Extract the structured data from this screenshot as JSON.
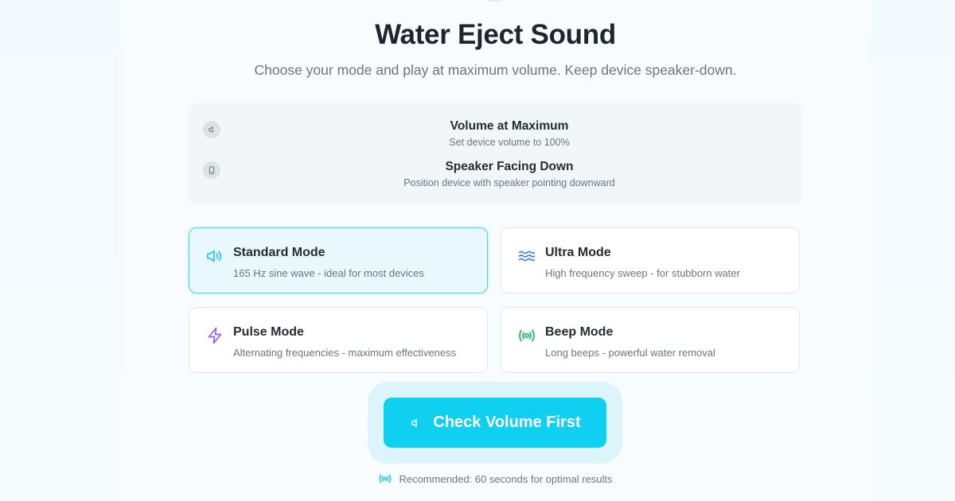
{
  "header": {
    "title": "Water Eject Sound",
    "subtitle": "Choose your mode and play at maximum volume. Keep device speaker-down."
  },
  "checklist": {
    "items": [
      {
        "icon": "speaker-icon",
        "title": "Volume at Maximum",
        "description": "Set device volume to 100%"
      },
      {
        "icon": "phone-icon",
        "title": "Speaker Facing Down",
        "description": "Position device with speaker pointing downward"
      }
    ]
  },
  "modes": {
    "selected": "Standard Mode",
    "items": [
      {
        "icon": "volume-wave-icon",
        "icon_color": "#2ec9ec",
        "title": "Standard Mode",
        "description": "165 Hz sine wave - ideal for most devices"
      },
      {
        "icon": "waves-icon",
        "icon_color": "#3d7ff2",
        "title": "Ultra Mode",
        "description": "High frequency sweep - for stubborn water"
      },
      {
        "icon": "lightning-icon",
        "icon_color": "#9b5ce6",
        "title": "Pulse Mode",
        "description": "Alternating frequencies - maximum effectiveness"
      },
      {
        "icon": "broadcast-icon",
        "icon_color": "#22c35e",
        "title": "Beep Mode",
        "description": "Long beeps - powerful water removal"
      }
    ]
  },
  "action": {
    "button_label": "Check Volume First",
    "button_icon": "speaker-icon",
    "button_color": "#10d0f2"
  },
  "footer": {
    "icon": "broadcast-icon",
    "icon_color": "#10c4ec",
    "recommendation": "Recommended: 60 seconds for optimal results"
  }
}
